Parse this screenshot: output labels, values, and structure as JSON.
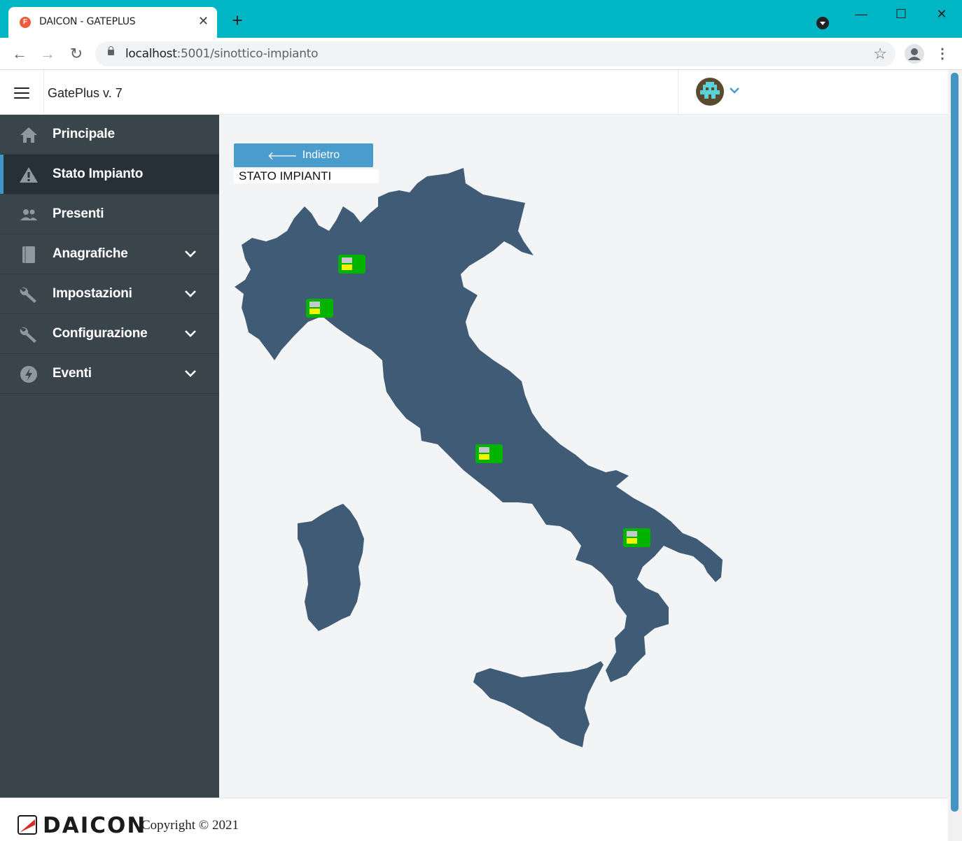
{
  "browser": {
    "tab_title": "DAICON - GATEPLUS",
    "url_host": "localhost",
    "url_path": ":5001/sinottico-impianto",
    "new_tab_icon": "plus-icon"
  },
  "app": {
    "title": "GatePlus v. 7"
  },
  "sidebar": {
    "items": [
      {
        "label": "Principale",
        "icon": "home-icon",
        "active": false,
        "expandable": false
      },
      {
        "label": "Stato Impianto",
        "icon": "warning-icon",
        "active": true,
        "expandable": false
      },
      {
        "label": "Presenti",
        "icon": "people-icon",
        "active": false,
        "expandable": false
      },
      {
        "label": "Anagrafiche",
        "icon": "book-icon",
        "active": false,
        "expandable": true
      },
      {
        "label": "Impostazioni",
        "icon": "wrench-icon",
        "active": false,
        "expandable": true
      },
      {
        "label": "Configurazione",
        "icon": "wrench-icon",
        "active": false,
        "expandable": true
      },
      {
        "label": "Eventi",
        "icon": "bolt-icon",
        "active": false,
        "expandable": true
      }
    ]
  },
  "main": {
    "back_label": "Indietro",
    "page_title": "STATO IMPIANTI",
    "map_region": "Italy",
    "plants": [
      {
        "status": "ok"
      },
      {
        "status": "ok"
      },
      {
        "status": "ok"
      },
      {
        "status": "ok"
      }
    ]
  },
  "footer": {
    "brand": "DAICON",
    "copyright": "Copyright © 2021"
  },
  "colors": {
    "browser_frame": "#00b5c4",
    "sidebar_bg": "#3a444b",
    "sidebar_active": "#273036",
    "accent": "#4a9ccc",
    "map_fill": "#405b75",
    "marker_ok": "#00b400",
    "marker_yellow": "#f6f300"
  }
}
